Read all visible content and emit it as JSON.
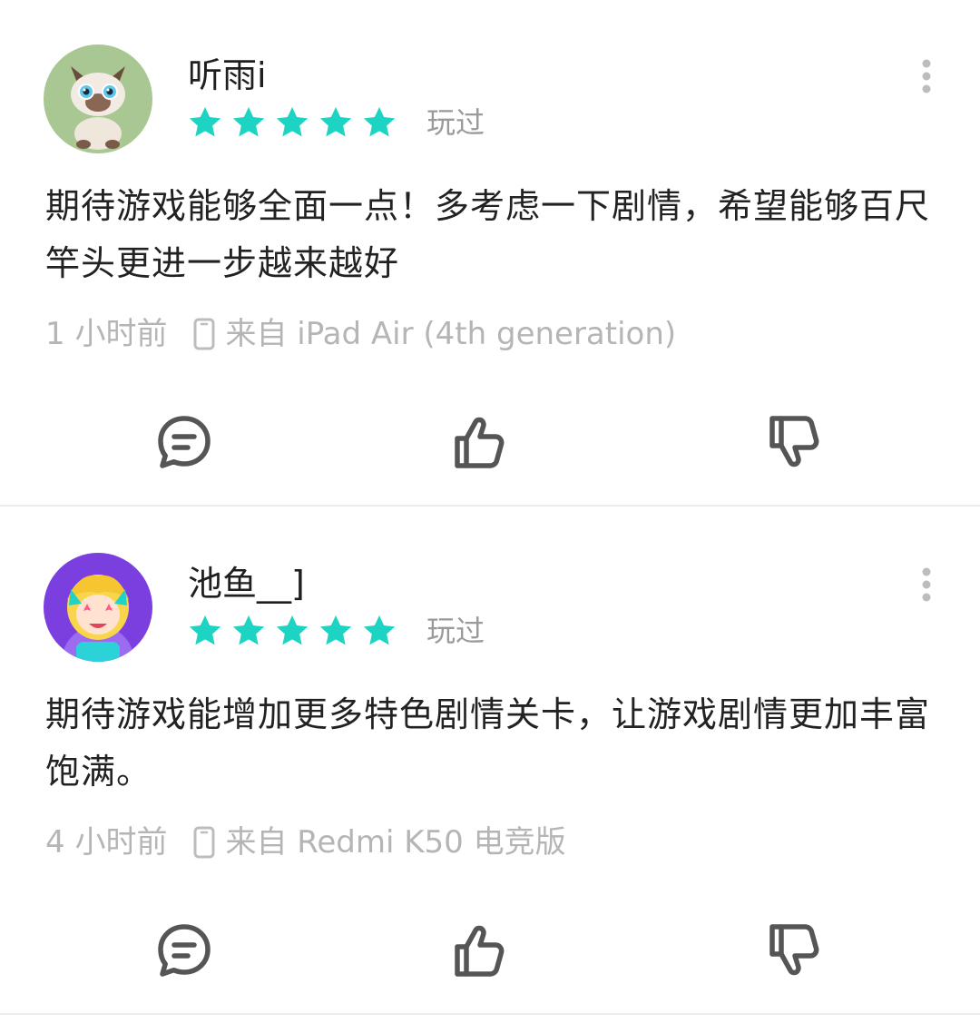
{
  "reviews": [
    {
      "username": "听雨i",
      "rating": 5,
      "played_label": "玩过",
      "content": "期待游戏能够全面一点！多考虑一下剧情，希望能够百尺竿头更进一步越来越好",
      "time": "1 小时前",
      "device": "来自 iPad Air (4th generation)",
      "avatar_icon": "cat-avatar-icon"
    },
    {
      "username": "池鱼__]",
      "rating": 5,
      "played_label": "玩过",
      "content": "期待游戏能增加更多特色剧情关卡，让游戏剧情更加丰富饱满。",
      "time": "4 小时前",
      "device": "来自 Redmi K50 电竞版",
      "avatar_icon": "anime-girl-avatar-icon"
    }
  ],
  "colors": {
    "star": "#1dd3c2",
    "muted_text": "#b5b5b5",
    "played_text": "#9a9a9a",
    "icon_stroke": "#555555",
    "divider": "#ececec"
  },
  "icons": {
    "comment": "comment-icon",
    "like": "thumbs-up-icon",
    "dislike": "thumbs-down-icon",
    "more": "more-vertical-icon",
    "device": "device-icon"
  }
}
